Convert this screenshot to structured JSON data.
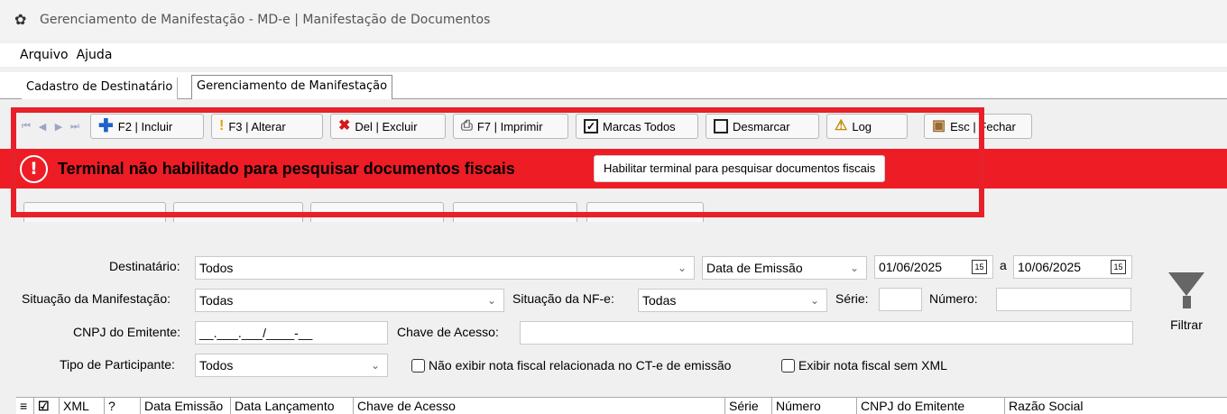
{
  "window": {
    "title": "Gerenciamento de Manifestação - MD-e | Manifestação de Documentos",
    "icon": "brazil-logo-icon"
  },
  "menu": {
    "items": [
      "Arquivo",
      "Ajuda"
    ]
  },
  "tabs": [
    {
      "label": "Cadastro de Destinatário"
    },
    {
      "label": "Gerenciamento de Manifestação"
    }
  ],
  "toolbar": {
    "include_label": "F2 | Incluir",
    "edit_label": "F3 | Alterar",
    "delete_label": "Del | Excluir",
    "print_label": "F7 | Imprimir",
    "mark_all_label": "Marcas Todos",
    "unmark_label": "Desmarcar",
    "log_label": "Log",
    "close_label": "Esc | Fechar"
  },
  "banner": {
    "message": "Terminal não habilitado para pesquisar documentos fiscais",
    "button_label": "Habilitar terminal para pesquisar documentos fiscais",
    "color": "#ee1c25"
  },
  "filters": {
    "destinatario_label": "Destinatário:",
    "destinatario_value": "Todos",
    "date_type_value": "Data de Emissão",
    "date_from": "01/06/2025",
    "date_sep": "a",
    "date_to": "10/06/2025",
    "situacao_manifestacao_label": "Situação da Manifestação:",
    "situacao_manifestacao_value": "Todas",
    "situacao_nfe_label": "Situação da NF-e:",
    "situacao_nfe_value": "Todas",
    "serie_label": "Série:",
    "serie_value": "",
    "numero_label": "Número:",
    "numero_value": "",
    "cnpj_label": "CNPJ do Emitente:",
    "cnpj_value": "__.___.___/____-__",
    "chave_label": "Chave de Acesso:",
    "chave_value": "",
    "tipo_participante_label": "Tipo de Participante:",
    "tipo_participante_value": "Todos",
    "chk_nao_exibir_label": "Não exibir nota fiscal relacionada no CT-e de emissão",
    "chk_sem_xml_label": "Exibir nota fiscal sem XML",
    "filter_button_label": "Filtrar"
  },
  "grid": {
    "columns": [
      "XML",
      "?",
      "Data Emissão",
      "Data Lançamento",
      "Chave de Acesso",
      "Série",
      "Número",
      "CNPJ do Emitente",
      "Razão Social"
    ]
  }
}
